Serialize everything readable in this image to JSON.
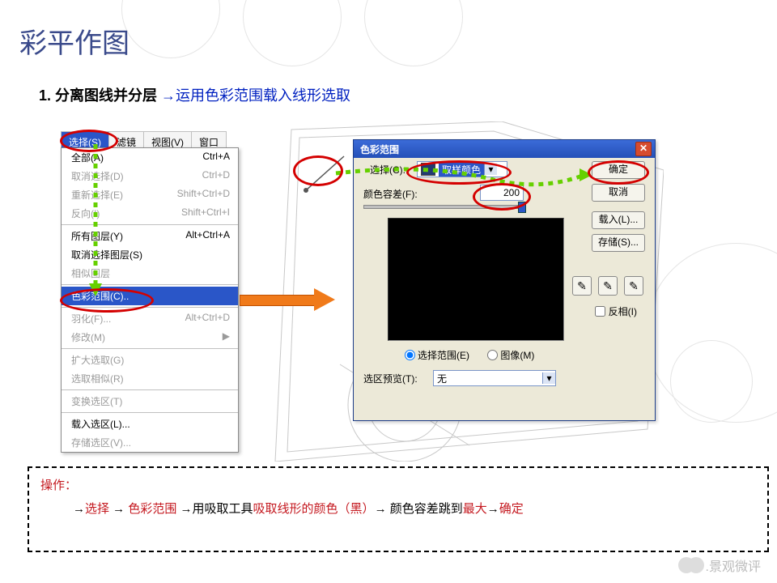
{
  "slide": {
    "title": "彩平作图",
    "sub_num": "1.",
    "sub_bold": " 分离图线并分层 ",
    "sub_arrow": "→",
    "sub_blue": "运用色彩范围载入线形选取"
  },
  "menu_tabs": {
    "active": "选择(S)",
    "t2": "滤镜",
    "t3": "视图(V)",
    "t4": "窗口"
  },
  "menu": {
    "all": {
      "label": "全部(A)",
      "sc": "Ctrl+A"
    },
    "deselect": {
      "label": "取消选择(D)",
      "sc": "Ctrl+D"
    },
    "reselect": {
      "label": "重新选择(E)",
      "sc": "Shift+Ctrl+D"
    },
    "inverse": {
      "label": "反向(I)",
      "sc": "Shift+Ctrl+I"
    },
    "alllayers": {
      "label": "所有图层(Y)",
      "sc": "Alt+Ctrl+A"
    },
    "deselectlayers": {
      "label": "取消选择图层(S)",
      "sc": ""
    },
    "similarlayers": {
      "label": "相似图层",
      "sc": ""
    },
    "colorrange": {
      "label": "色彩范围(C)..",
      "sc": ""
    },
    "feather": {
      "label": "羽化(F)...",
      "sc": "Alt+Ctrl+D"
    },
    "modify": {
      "label": "修改(M)",
      "sc": "▶"
    },
    "grow": {
      "label": "扩大选取(G)",
      "sc": ""
    },
    "similar": {
      "label": "选取相似(R)",
      "sc": ""
    },
    "transform": {
      "label": "变换选区(T)",
      "sc": ""
    },
    "load": {
      "label": "载入选区(L)...",
      "sc": ""
    },
    "save": {
      "label": "存储选区(V)...",
      "sc": ""
    }
  },
  "dialog": {
    "title": "色彩范围",
    "select_label": "选择(C):",
    "select_value": "取样颜色",
    "fuzz_label": "颜色容差(F):",
    "fuzz_value": "200",
    "radio1": "选择范围(E)",
    "radio2": "图像(M)",
    "preview_label": "选区预览(T):",
    "preview_value": "无",
    "ok": "确定",
    "cancel": "取消",
    "loadbtn": "载入(L)...",
    "savebtn": "存储(S)...",
    "invert": "反相(I)"
  },
  "instr": {
    "head": "操作：",
    "line": "→选择 → 色彩范围 →用吸取工具吸取线形的颜色（黑）→ 颜色容差跳到最大→确定",
    "p1a": "→",
    "p1b": "选择",
    "p1c": " → ",
    "p1d": "色彩范围",
    "p1e": " →用吸取工具",
    "p1f": "吸取线形的颜色（黑）",
    "p1g": "→ 颜色容差跳到",
    "p1h": "最大",
    "p1i": "→",
    "p1j": "确定"
  },
  "wm": ".景观微评"
}
